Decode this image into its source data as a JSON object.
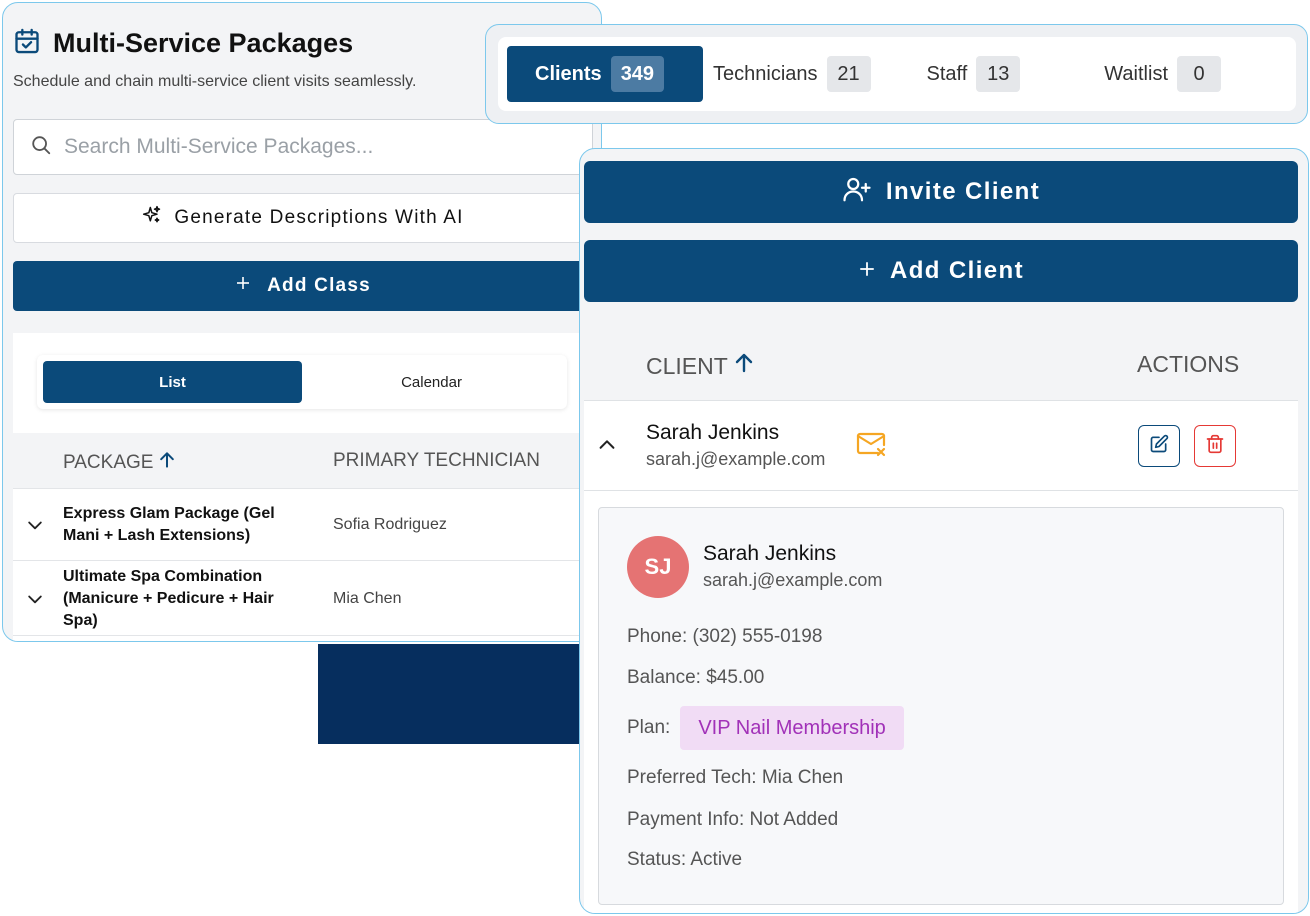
{
  "packages": {
    "title": "Multi-Service Packages",
    "subtitle": "Schedule and chain multi-service client visits seamlessly.",
    "search_placeholder": "Search Multi-Service Packages...",
    "generate_ai_label": "Generate Descriptions With AI",
    "add_class_label": "Add Class",
    "view_toggle": {
      "list": "List",
      "calendar": "Calendar",
      "selected": "List"
    },
    "columns": {
      "package": "PACKAGE",
      "primary_technician": "PRIMARY TECHNICIAN"
    },
    "rows": [
      {
        "name": "Express Glam Package (Gel Mani + Lash Extensions)",
        "technician": "Sofia Rodriguez"
      },
      {
        "name": "Ultimate Spa Combination (Manicure + Pedicure + Hair Spa)",
        "technician": "Mia Chen"
      }
    ]
  },
  "tabs": [
    {
      "label": "Clients",
      "count": "349",
      "active": true
    },
    {
      "label": "Technicians",
      "count": "21",
      "active": false
    },
    {
      "label": "Staff",
      "count": "13",
      "active": false
    },
    {
      "label": "Waitlist",
      "count": "0",
      "active": false
    }
  ],
  "clients": {
    "invite_label": "Invite Client",
    "add_label": "Add Client",
    "columns": {
      "client": "CLIENT",
      "actions": "ACTIONS"
    },
    "row": {
      "name": "Sarah Jenkins",
      "email": "sarah.j@example.com"
    },
    "detail": {
      "initials": "SJ",
      "name": "Sarah Jenkins",
      "email": "sarah.j@example.com",
      "phone": "Phone: (302) 555-0198",
      "balance": "Balance: $45.00",
      "plan_label": "Plan:",
      "plan_value": "VIP Nail Membership",
      "preferred_tech": "Preferred Tech: Mia Chen",
      "payment_info": "Payment Info: Not Added",
      "status": "Status: Active"
    }
  },
  "colors": {
    "primary": "#0b4a7a",
    "border_accent": "#7cc8ec",
    "avatar": "#e57373",
    "plan_chip_bg": "#f1dcf5",
    "plan_chip_text": "#a131b8",
    "delete": "#e53935",
    "mail_warning": "#f5a623"
  },
  "icons": {
    "title_icon": "calendar-check-icon",
    "search": "search-icon",
    "ai": "sparkles-icon",
    "add": "plus-icon",
    "sort": "arrow-up-icon",
    "expand": "chevron-down-icon",
    "collapse": "chevron-up-icon",
    "invite": "user-plus-icon",
    "mail_status": "mail-x-icon",
    "edit": "edit-icon",
    "delete": "trash-icon"
  }
}
